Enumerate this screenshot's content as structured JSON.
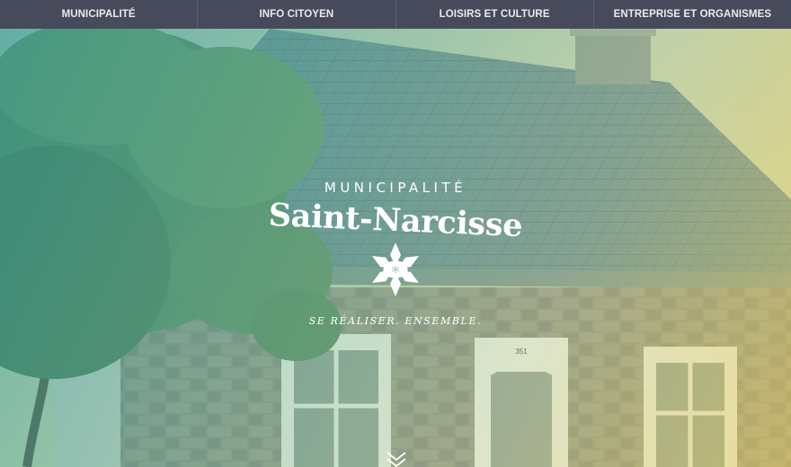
{
  "nav": {
    "items": [
      {
        "label": "MUNICIPALITÉ"
      },
      {
        "label": "INFO CITOYEN"
      },
      {
        "label": "LOISIRS ET CULTURE"
      },
      {
        "label": "ENTREPRISE ET ORGANISMES"
      }
    ]
  },
  "hero": {
    "eyebrow": "MUNICIPALITÉ",
    "title": "Saint-Narcisse",
    "slogan": "SE RÉALISER. ENSEMBLE.",
    "house_number": "351",
    "scroll_icon": "chevron-down-icon",
    "logo_icon": "flower-icon"
  },
  "colors": {
    "nav_bg": "#474a5b",
    "nav_text": "#e9ebf0",
    "overlay_teal": "#1e9696",
    "overlay_yellow": "#ebcd5a",
    "logo_white": "#ffffff"
  }
}
